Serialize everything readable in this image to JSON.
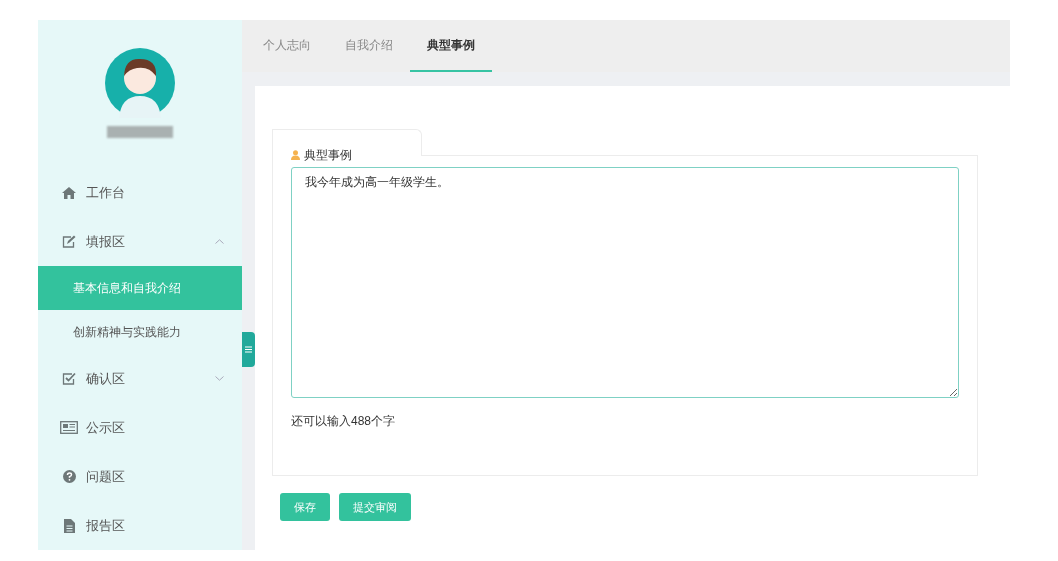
{
  "sidebar": {
    "items": [
      {
        "kind": "item",
        "label": "工作台"
      },
      {
        "kind": "group",
        "label": "填报区",
        "expanded": true,
        "children": [
          {
            "label": "基本信息和自我介绍",
            "selected": true
          },
          {
            "label": "创新精神与实践能力",
            "selected": false
          }
        ]
      },
      {
        "kind": "group",
        "label": "确认区",
        "expanded": false
      },
      {
        "kind": "item",
        "label": "公示区"
      },
      {
        "kind": "item",
        "label": "问题区"
      },
      {
        "kind": "item",
        "label": "报告区"
      }
    ]
  },
  "tabs": [
    {
      "label": "个人志向",
      "selected": false
    },
    {
      "label": "自我介绍",
      "selected": false
    },
    {
      "label": "典型事例",
      "selected": true
    }
  ],
  "form": {
    "section_title": "典型事例",
    "value": "我今年成为高一年级学生。",
    "counter": "还可以输入488个字"
  },
  "buttons": [
    "保存",
    "提交审阅"
  ]
}
